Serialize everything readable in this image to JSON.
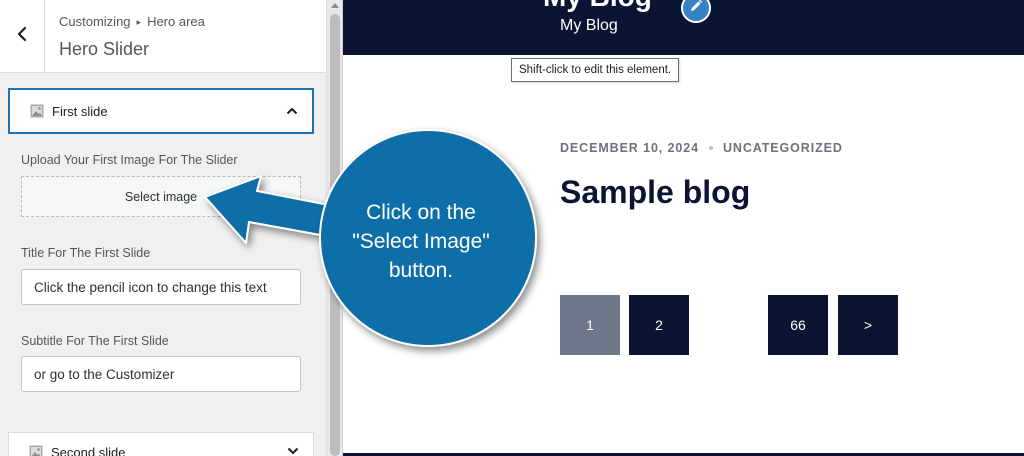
{
  "sidebar": {
    "breadcrumb": {
      "parent": "Customizing",
      "separator": "▸",
      "current": "Hero area"
    },
    "title": "Hero Slider",
    "first_section": {
      "label": "First slide"
    },
    "upload_label": "Upload Your First Image For The Slider",
    "select_image_label": "Select image",
    "title_label": "Title For The First Slide",
    "title_value": "Click the pencil icon to change this text",
    "subtitle_label": "Subtitle For The First Slide",
    "subtitle_value": "or go to the Customizer",
    "second_section": {
      "label": "Second slide"
    }
  },
  "preview": {
    "site_title": "My Blog",
    "tagline": "My Blog",
    "tooltip": "Shift-click to edit this element.",
    "post": {
      "date": "DECEMBER 10, 2024",
      "category": "UNCATEGORIZED",
      "title": "Sample blog"
    },
    "pagination": [
      "1",
      "2",
      "66",
      ">"
    ]
  },
  "annotation": {
    "line1": "Click on the",
    "line2": "\"Select Image\"",
    "line3": "button."
  },
  "colors": {
    "accent": "#2271b1",
    "site_header": "#0c1434",
    "callout_blue": "#0e6ea8",
    "pager_current": "#6d7789"
  }
}
